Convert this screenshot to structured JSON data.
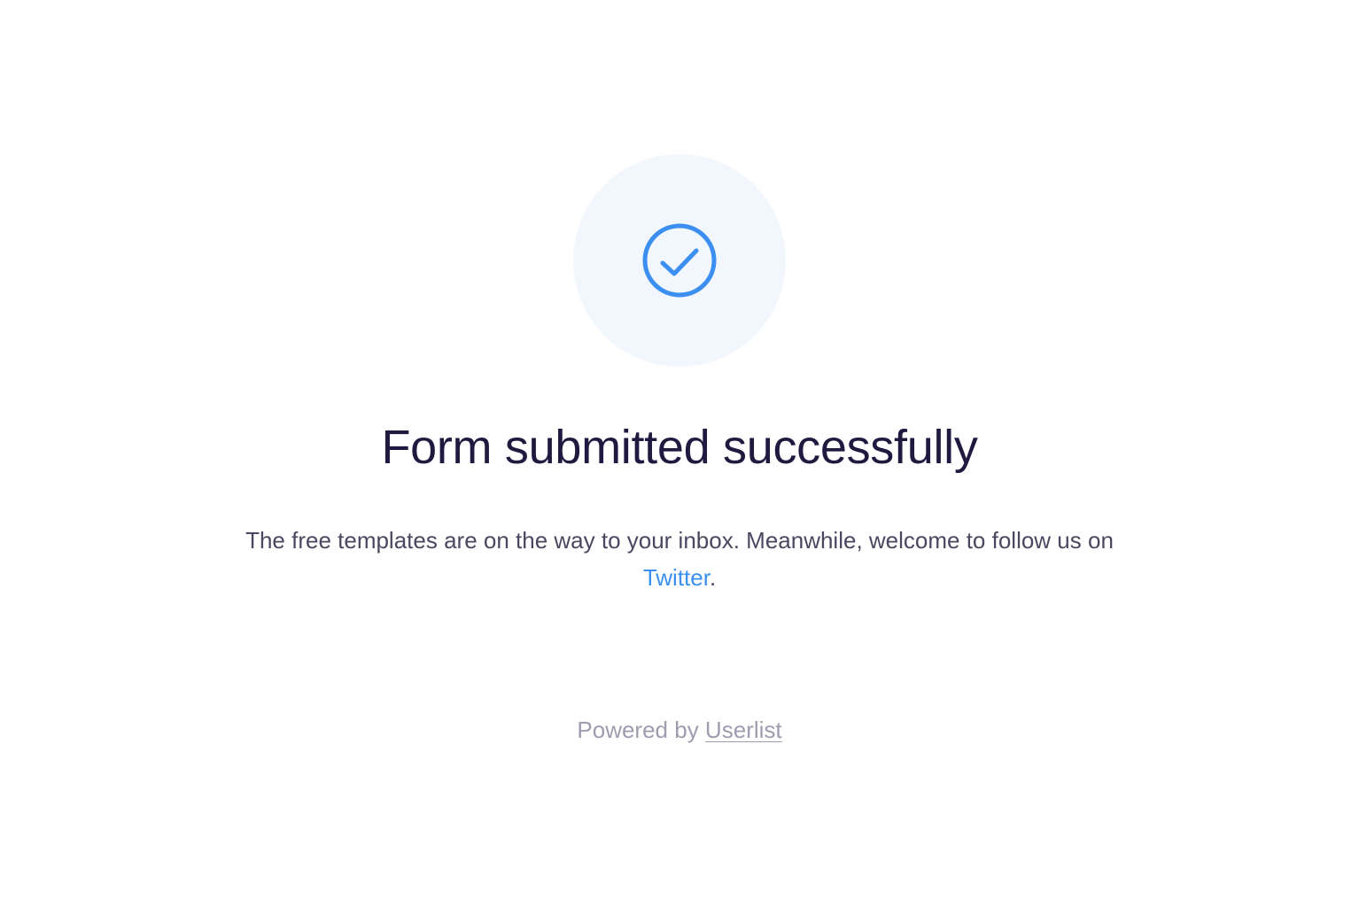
{
  "success": {
    "icon": "check-circle-icon",
    "icon_color": "#3b8ff0",
    "badge_bg": "#f1f7fd",
    "title": "Form submitted successfully",
    "message_prefix": "The free templates are on the way to your inbox. Meanwhile, welcome to follow us on ",
    "link_text": "Twitter",
    "message_suffix": "."
  },
  "footer": {
    "powered_by": "Powered by ",
    "brand_link": "Userlist"
  }
}
